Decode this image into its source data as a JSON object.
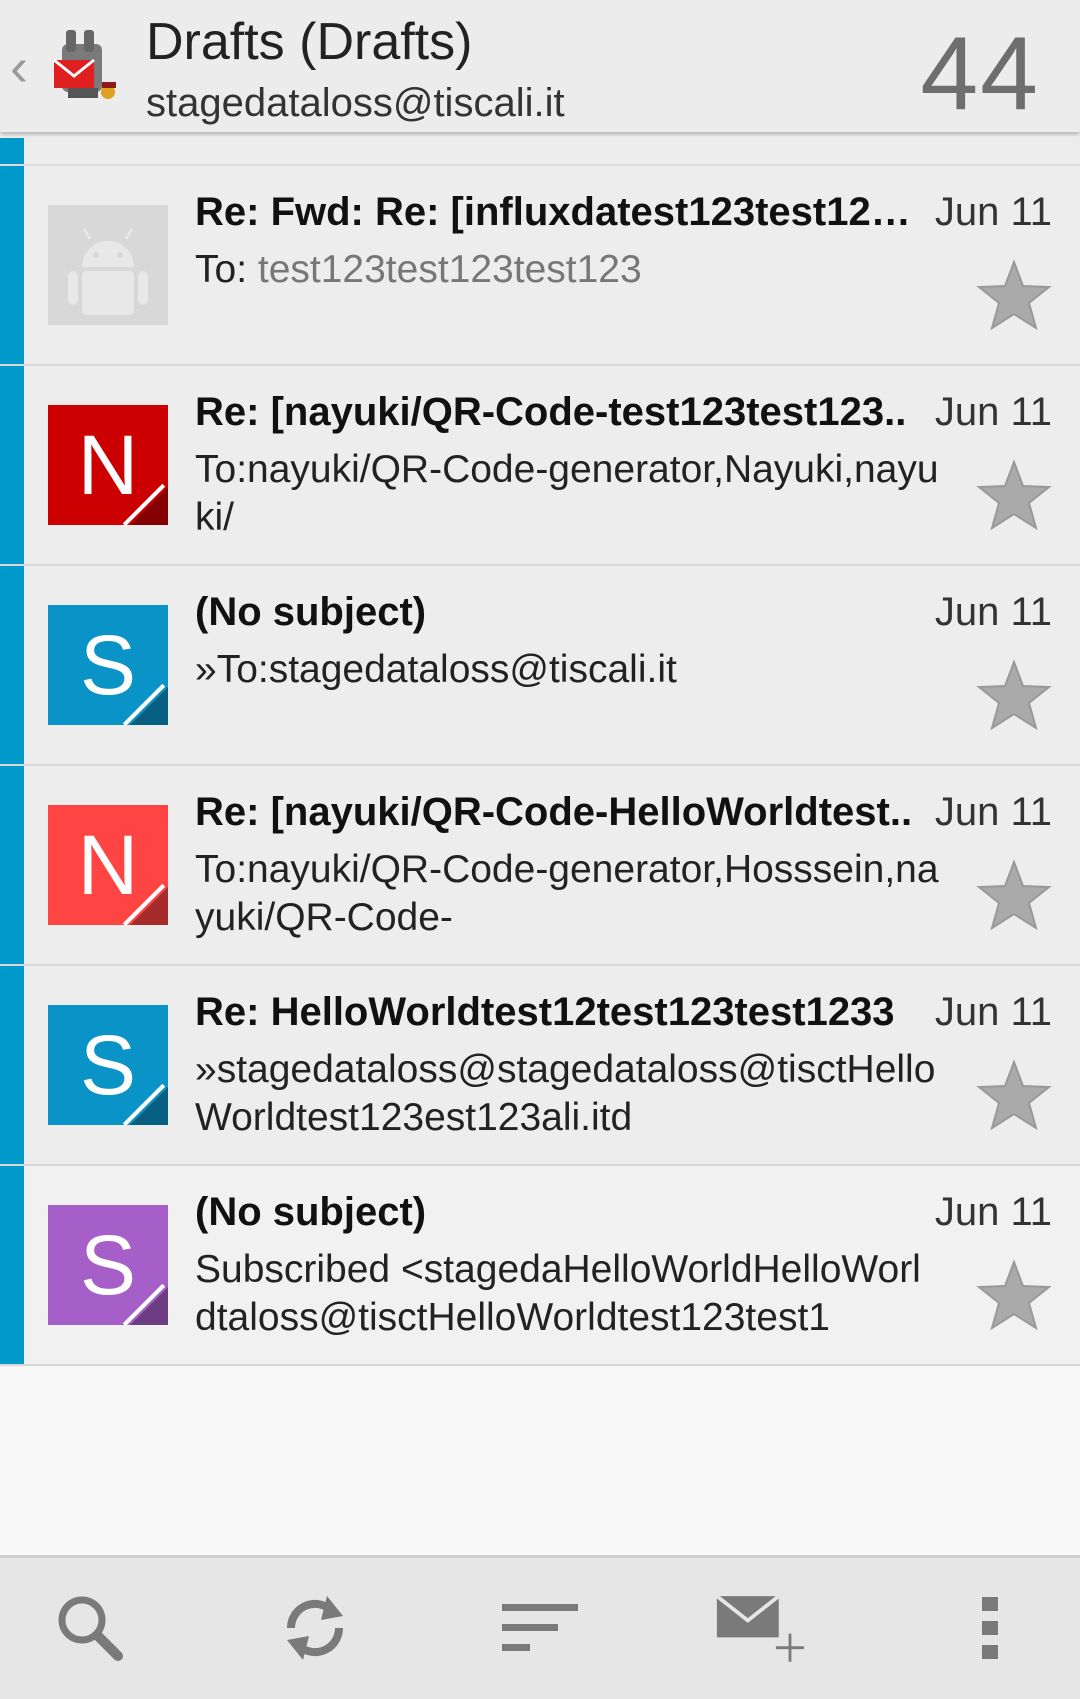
{
  "header": {
    "title": "Drafts (Drafts)",
    "account": "stagedataloss@tiscali.it",
    "count": "44"
  },
  "messages": [
    {
      "subject": "Re: Fwd: Re: [influxdatest123test123..",
      "date": "Jun 11",
      "to_label": "To:",
      "to_value": " test123test123test123",
      "avatar_letter": "",
      "avatar_color": "#d6d6d6",
      "starred": false
    },
    {
      "subject": "Re: [nayuki/QR-Code-test123test123..",
      "date": "Jun 11",
      "preview": "To:nayuki/QR-Code-generator,Nayuki,nayuki/",
      "avatar_letter": "N",
      "avatar_color": "#cc0000",
      "starred": false
    },
    {
      "subject": "(No subject)",
      "date": "Jun 11",
      "preview": "»To:stagedataloss@tiscali.it",
      "avatar_letter": "S",
      "avatar_color": "#0a93c7",
      "starred": false
    },
    {
      "subject": "Re: [nayuki/QR-Code-HelloWorldtest..",
      "date": "Jun 11",
      "preview": "To:nayuki/QR-Code-generator,Hosssein,nayuki/QR-Code-",
      "avatar_letter": "N",
      "avatar_color": "#ff4444",
      "starred": false
    },
    {
      "subject": "Re: HelloWorldtest12test123test1233",
      "date": "Jun 11",
      "preview": "»stagedataloss@stagedataloss@tisctHelloWorldtest123est123ali.itd",
      "avatar_letter": "S",
      "avatar_color": "#0a93c7",
      "starred": false
    },
    {
      "subject": "(No subject)",
      "date": "Jun 11",
      "preview": "Subscribed <stagedaHelloWorldHelloWorldtaloss@tisctHelloWorldtest123test1",
      "avatar_letter": "S",
      "avatar_color": "#a65fc9",
      "starred": false
    }
  ],
  "colors": {
    "accent": "#0099cc",
    "star": "#aaaaaa"
  },
  "toolbar": {
    "icons": [
      "search-icon",
      "refresh-icon",
      "sort-icon",
      "compose-icon",
      "overflow-menu-icon"
    ]
  }
}
